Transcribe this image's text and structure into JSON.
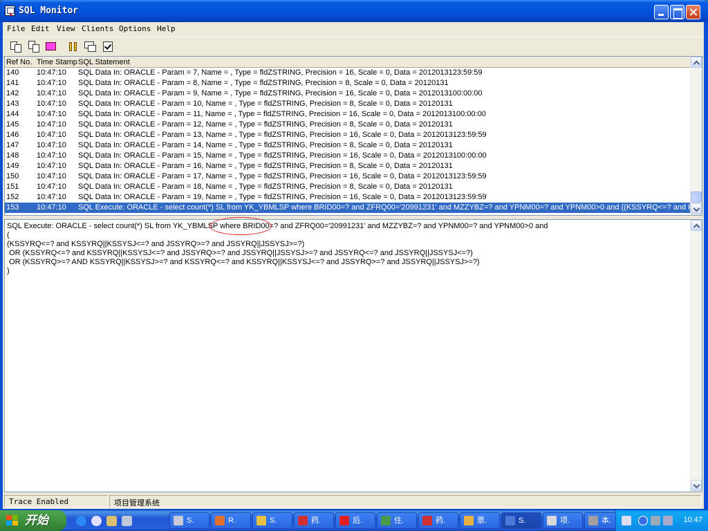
{
  "window": {
    "title": "SQL Monitor"
  },
  "menu": [
    "File",
    "Edit",
    "View",
    "Clients",
    "Options",
    "Help"
  ],
  "list": {
    "columns": {
      "ref": "Ref No.",
      "time": "Time Stamp",
      "sql": "SQL Statement"
    },
    "rows": [
      {
        "ref": "140",
        "time": "10:47:10",
        "sql": "SQL Data In: ORACLE - Param = 7, Name = , Type = fldZSTRING, Precision = 16, Scale = 0, Data = 2012013123:59:59"
      },
      {
        "ref": "141",
        "time": "10:47:10",
        "sql": "SQL Data In: ORACLE - Param = 8, Name = , Type = fldZSTRING, Precision = 8, Scale = 0, Data = 20120131"
      },
      {
        "ref": "142",
        "time": "10:47:10",
        "sql": "SQL Data In: ORACLE - Param = 9, Name = , Type = fldZSTRING, Precision = 16, Scale = 0, Data = 2012013100:00:00"
      },
      {
        "ref": "143",
        "time": "10:47:10",
        "sql": "SQL Data In: ORACLE - Param = 10, Name = , Type = fldZSTRING, Precision = 8, Scale = 0, Data = 20120131"
      },
      {
        "ref": "144",
        "time": "10:47:10",
        "sql": "SQL Data In: ORACLE - Param = 11, Name = , Type = fldZSTRING, Precision = 16, Scale = 0, Data = 2012013100:00:00"
      },
      {
        "ref": "145",
        "time": "10:47:10",
        "sql": "SQL Data In: ORACLE - Param = 12, Name = , Type = fldZSTRING, Precision = 8, Scale = 0, Data = 20120131"
      },
      {
        "ref": "146",
        "time": "10:47:10",
        "sql": "SQL Data In: ORACLE - Param = 13, Name = , Type = fldZSTRING, Precision = 16, Scale = 0, Data = 2012013123:59:59"
      },
      {
        "ref": "147",
        "time": "10:47:10",
        "sql": "SQL Data In: ORACLE - Param = 14, Name = , Type = fldZSTRING, Precision = 8, Scale = 0, Data = 20120131"
      },
      {
        "ref": "148",
        "time": "10:47:10",
        "sql": "SQL Data In: ORACLE - Param = 15, Name = , Type = fldZSTRING, Precision = 16, Scale = 0, Data = 2012013100:00:00"
      },
      {
        "ref": "149",
        "time": "10:47:10",
        "sql": "SQL Data In: ORACLE - Param = 16, Name = , Type = fldZSTRING, Precision = 8, Scale = 0, Data = 20120131"
      },
      {
        "ref": "150",
        "time": "10:47:10",
        "sql": "SQL Data In: ORACLE - Param = 17, Name = , Type = fldZSTRING, Precision = 16, Scale = 0, Data = 2012013123:59:59"
      },
      {
        "ref": "151",
        "time": "10:47:10",
        "sql": "SQL Data In: ORACLE - Param = 18, Name = , Type = fldZSTRING, Precision = 8, Scale = 0, Data = 20120131"
      },
      {
        "ref": "152",
        "time": "10:47:10",
        "sql": "SQL Data In: ORACLE - Param = 19, Name = , Type = fldZSTRING, Precision = 16, Scale = 0, Data = 2012013123:59:59"
      },
      {
        "ref": "153",
        "time": "10:47:10",
        "sql": "SQL Execute: ORACLE - select count(*) SL from YK_YBMLSP where BRID00=? and ZFRQ00='20991231' and MZZYBZ=? and YPNM00=? and YPNM00>0 and ((KSSYRQ<=? and KSSY",
        "selected": true
      }
    ]
  },
  "detail": {
    "lines": [
      "SQL Execute: ORACLE - select count(*) SL from YK_YBMLSP where BRID00=? and ZFRQ00='20991231' and MZZYBZ=? and YPNM00=? and YPNM00>0 and",
      "(",
      "(KSSYRQ<=? and KSSYRQ||KSSYSJ<=? and JSSYRQ>=? and JSSYRQ||JSSYSJ>=?)",
      " OR (KSSYRQ<=? and KSSYRQ||KSSYSJ<=? and JSSYRQ>=? and JSSYRQ||JSSYSJ>=? and JSSYRQ<=? and JSSYRQ||JSSYSJ<=?)",
      " OR (KSSYRQ>=? AND KSSYRQ||KSSYSJ>=? and KSSYRQ<=? and KSSYRQ||KSSYSJ<=? and JSSYRQ>=? and JSSYRQ||JSSYSJ>=?)",
      ")"
    ]
  },
  "status": {
    "trace": "Trace Enabled",
    "project": "项目管理系统"
  },
  "taskbar": {
    "start": "开始",
    "tasks": [
      "S.",
      "R.",
      "S.",
      "药.",
      "后.",
      "住.",
      "药.",
      "票.",
      "S.",
      "项.",
      "本."
    ],
    "clock": "10:47"
  },
  "colors": {
    "selection": "#316ac5",
    "titlebar": "#0452dc",
    "annotation": "#e02020"
  }
}
